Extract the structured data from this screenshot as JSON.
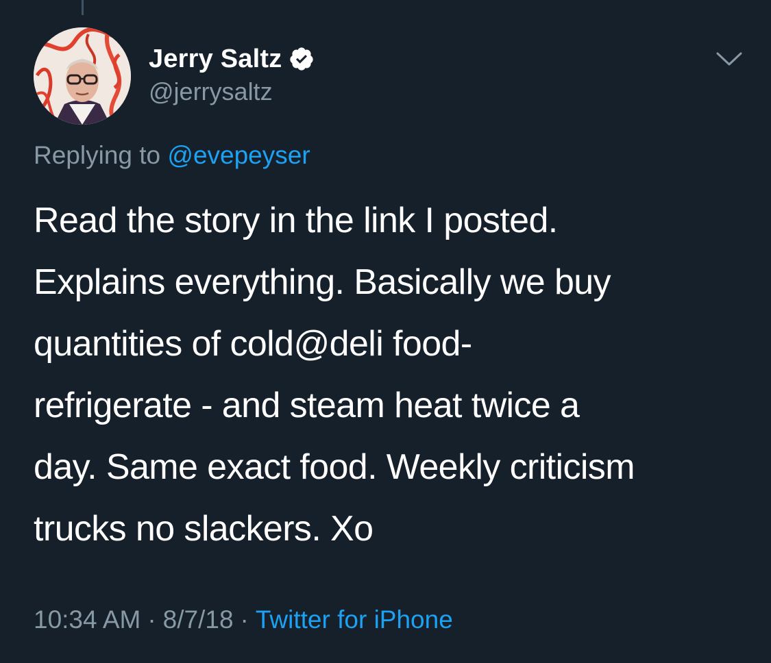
{
  "tweet": {
    "author": {
      "display_name": "Jerry Saltz",
      "handle": "@jerrysaltz",
      "verified": true
    },
    "reply": {
      "prefix": "Replying to ",
      "mention": "@evepeyser"
    },
    "text_lines": [
      "Read the story in the link I posted.",
      "Explains everything. Basically we buy",
      "quantities of cold@deli food-",
      "refrigerate - and steam heat twice a",
      "day. Same exact food. Weekly criticism",
      "trucks no slackers. Xo"
    ],
    "meta": {
      "time": "10:34 AM",
      "separator": "·",
      "date": "8/7/18",
      "source": "Twitter for iPhone"
    }
  },
  "icons": {
    "verified": "verified-badge-icon",
    "menu": "chevron-down-icon"
  },
  "colors": {
    "background": "#15202b",
    "primary_text": "#ffffff",
    "secondary_text": "#8899a6",
    "link": "#1da1f2"
  }
}
